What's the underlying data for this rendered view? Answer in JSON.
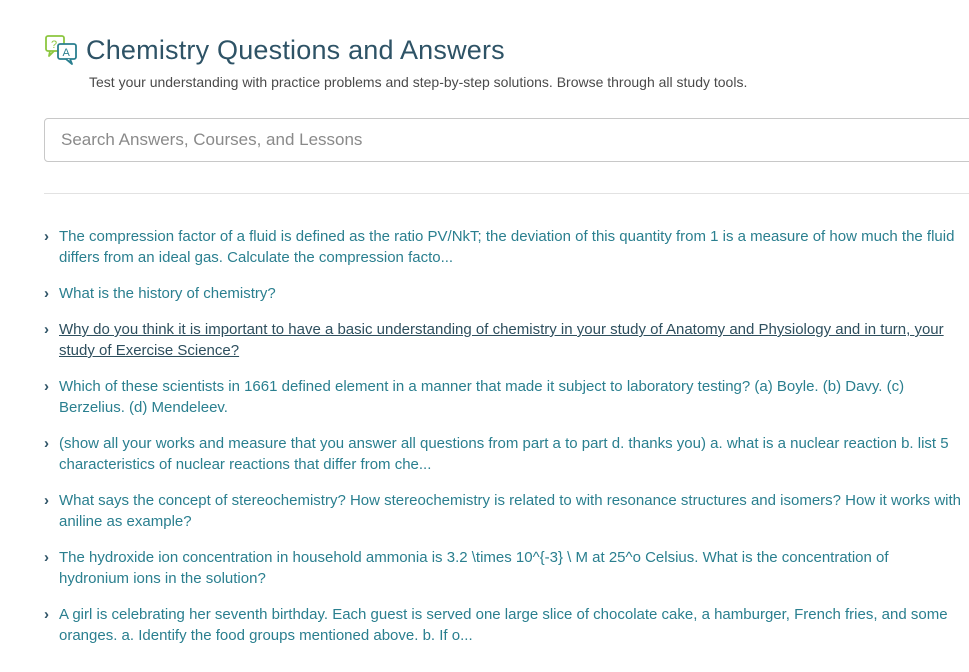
{
  "header": {
    "icon": "question-answer-icon",
    "title": "Chemistry Questions and Answers",
    "subtitle": "Test your understanding with practice problems and step-by-step solutions. Browse through all study tools."
  },
  "search": {
    "placeholder": "Search Answers, Courses, and Lessons"
  },
  "questions": [
    "The compression factor of a fluid is defined as the ratio PV/NkT; the deviation of this quantity from 1 is a measure of how much the fluid differs from an ideal gas. Calculate the compression facto...",
    "What is the history of chemistry?",
    "Why do you think it is important to have a basic understanding of chemistry in your study of Anatomy and Physiology and in turn, your study of Exercise Science?",
    "Which of these scientists in 1661 defined element in a manner that made it subject to laboratory testing? (a) Boyle. (b) Davy. (c) Berzelius. (d) Mendeleev.",
    "(show all your works and measure that you answer all questions from part a to part d. thanks you) a. what is a nuclear reaction b. list 5 characteristics of nuclear reactions that differ from che...",
    "What says the concept of stereochemistry? How stereochemistry is related to with resonance structures and isomers? How it works with aniline as example?",
    "The hydroxide ion concentration in household ammonia is 3.2 \\times 10^{-3} \\ M at 25^o Celsius. What is the concentration of hydronium ions in the solution?",
    "A girl is celebrating her seventh birthday. Each guest is served one large slice of chocolate cake, a hamburger, French fries, and some oranges. a. Identify the food groups mentioned above. b. If o..."
  ],
  "chevron_icon": "chevron-right-icon",
  "colors": {
    "title": "#2e5366",
    "link": "#2a7f8f",
    "icon_green": "#8cc63f",
    "icon_teal": "#2a7f8f"
  }
}
